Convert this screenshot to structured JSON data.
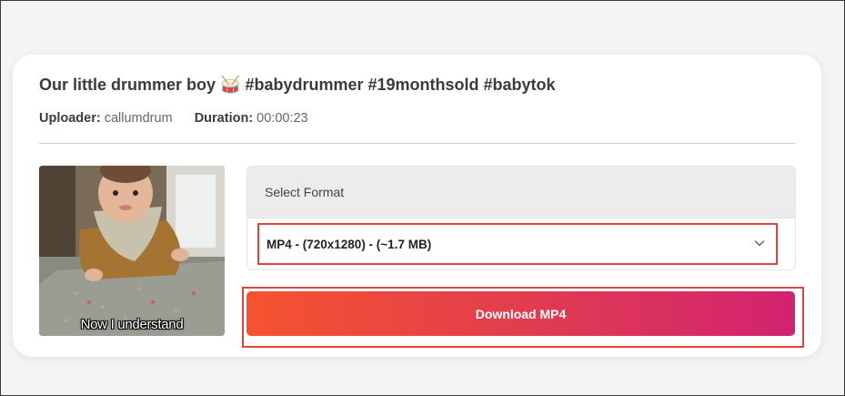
{
  "video": {
    "title": "Our little drummer boy 🥁 #babydrummer #19monthsold #babytok",
    "uploader_label": "Uploader:",
    "uploader": "callumdrum",
    "duration_label": "Duration:",
    "duration": "00:00:23",
    "thumbnail_caption": "Now I understand"
  },
  "format": {
    "heading": "Select Format",
    "selected": "MP4 - (720x1280) - (~1.7 MB)"
  },
  "download": {
    "label": "Download MP4"
  },
  "colors": {
    "highlight": "#e0443f",
    "gradient_start": "#f5532f",
    "gradient_end": "#d22271"
  }
}
